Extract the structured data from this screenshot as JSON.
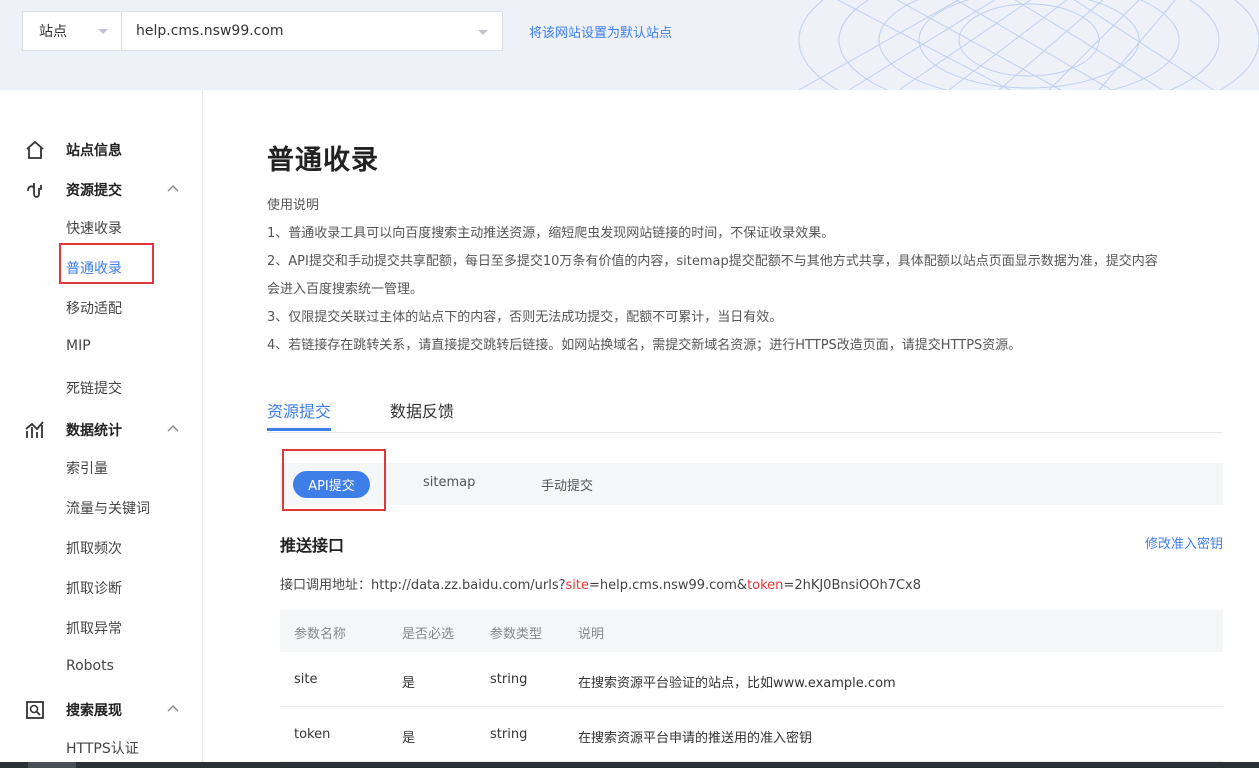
{
  "header": {
    "site_label": "站点",
    "domain_value": "help.cms.nsw99.com",
    "default_link": "将该网站设置为默认站点"
  },
  "sidebar": {
    "groups": [
      {
        "label": "站点信息",
        "icon": "home-icon"
      },
      {
        "label": "资源提交",
        "icon": "link-icon",
        "items": [
          "快速收录",
          "普通收录",
          "移动适配",
          "MIP",
          "死链提交"
        ]
      },
      {
        "label": "数据统计",
        "icon": "chart-icon",
        "items": [
          "索引量",
          "流量与关键词",
          "抓取频次",
          "抓取诊断",
          "抓取异常",
          "Robots"
        ]
      },
      {
        "label": "搜索展现",
        "icon": "search-display-icon",
        "items": [
          "HTTPS认证"
        ]
      }
    ],
    "active_item": "普通收录"
  },
  "main": {
    "title": "普通收录",
    "desc": [
      "使用说明",
      "1、普通收录工具可以向百度搜索主动推送资源，缩短爬虫发现网站链接的时间，不保证收录效果。",
      "2、API提交和手动提交共享配额，每日至多提交10万条有价值的内容，sitemap提交配额不与其他方式共享，具体配额以站点页面显示数据为准，提交内容",
      "会进入百度搜索统一管理。",
      "3、仅限提交关联过主体的站点下的内容，否则无法成功提交，配额不可累计，当日有效。",
      "4、若链接存在跳转关系，请直接提交跳转后链接。如网站换域名，需提交新域名资源；进行HTTPS改造页面，请提交HTTPS资源。"
    ],
    "tabs": [
      "资源提交",
      "数据反馈"
    ],
    "subtabs": [
      "API提交",
      "sitemap",
      "手动提交"
    ],
    "section_title": "推送接口",
    "edit_link": "修改准入密钥",
    "api": {
      "prefix": "接口调用地址：http://data.zz.baidu.com/urls?",
      "p1": "site",
      "mid": "=help.cms.nsw99.com&",
      "p2": "token",
      "suffix": "=2hKJ0BnsiOOh7Cx8"
    },
    "table": {
      "headers": [
        "参数名称",
        "是否必选",
        "参数类型",
        "说明"
      ],
      "rows": [
        [
          "site",
          "是",
          "string",
          "在搜索资源平台验证的站点，比如www.example.com"
        ],
        [
          "token",
          "是",
          "string",
          "在搜索资源平台申请的推送用的准入密钥"
        ]
      ]
    }
  },
  "colors": {
    "accent": "#3e7ee8",
    "highlight_red": "#e0373a"
  }
}
